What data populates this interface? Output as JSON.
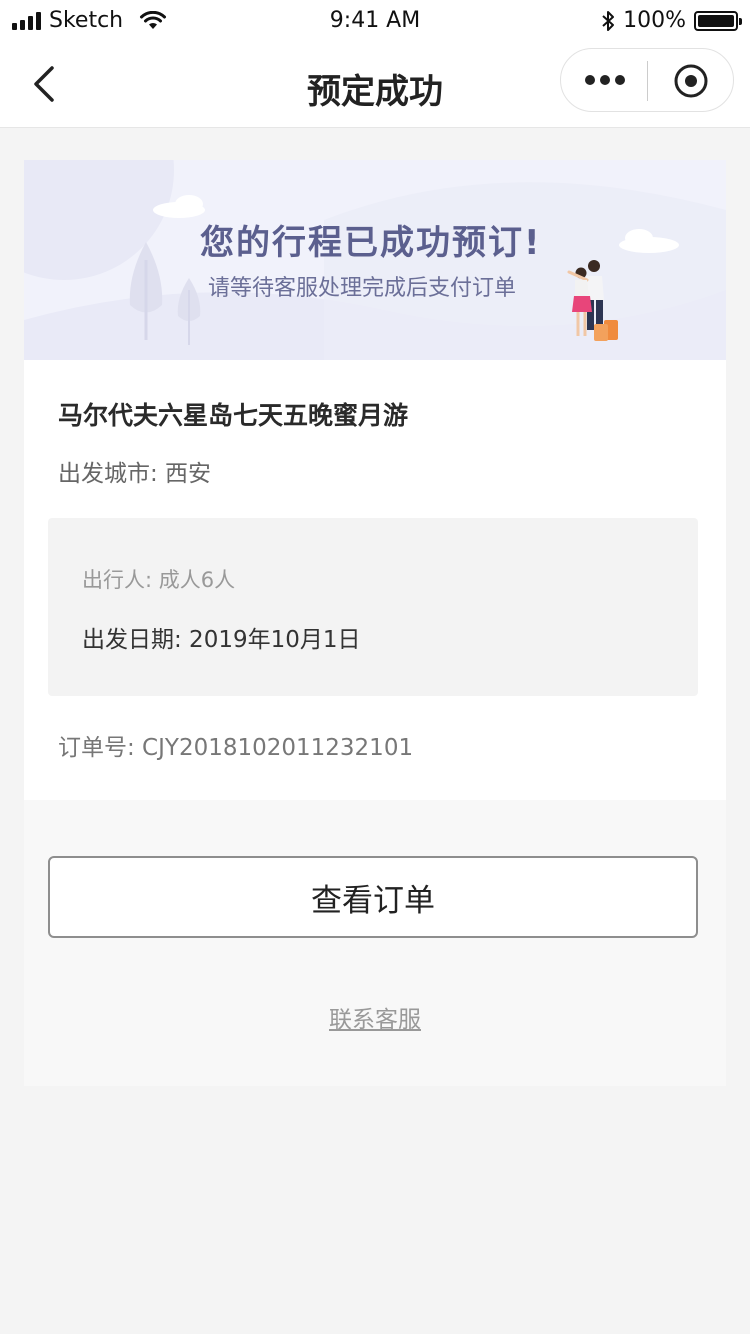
{
  "status_bar": {
    "carrier": "Sketch",
    "time": "9:41 AM",
    "battery_percent": "100%",
    "battery_level": 1.0
  },
  "nav": {
    "title": "预定成功"
  },
  "banner": {
    "title": "您的行程已成功预订!",
    "subtitle": "请等待客服处理完成后支付订单"
  },
  "order": {
    "trip_name": "马尔代夫六星岛七天五晚蜜月游",
    "departure_city": "出发城市: 西安",
    "travelers": "出行人: 成人6人",
    "departure_date": "出发日期: 2019年10月1日",
    "order_number": "订单号: CJY2018102011232101"
  },
  "actions": {
    "view_order": "查看订单",
    "contact_service": "联系客服"
  },
  "colors": {
    "page_bg": "#f4f4f4",
    "banner_bg": "#f1f2fb",
    "banner_text": "#5b5f8e",
    "detail_bg": "#f3f3f3"
  }
}
